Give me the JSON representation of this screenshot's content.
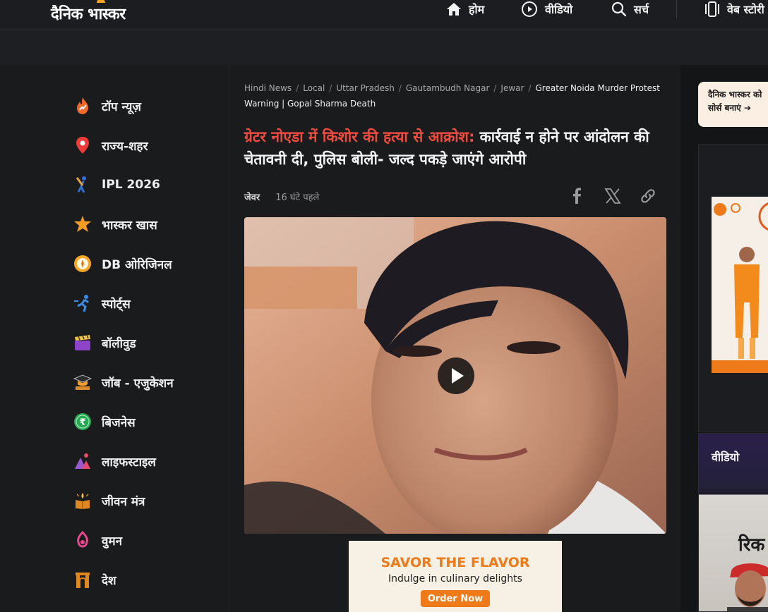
{
  "header": {
    "logo_text": "दैनिक भास्कर",
    "nav": [
      {
        "label": "होम",
        "icon": "home-icon"
      },
      {
        "label": "वीडियो",
        "icon": "play-circle-icon"
      },
      {
        "label": "सर्च",
        "icon": "search-icon"
      },
      {
        "label": "वेब स्टोरी",
        "icon": "web-story-icon"
      }
    ]
  },
  "sidebar": {
    "items": [
      {
        "label": "टॉप न्यूज़",
        "icon": "fire-icon"
      },
      {
        "label": "राज्य-शहर",
        "icon": "location-pin-icon"
      },
      {
        "label": "IPL 2026",
        "icon": "cricket-batter-icon"
      },
      {
        "label": "भास्कर खास",
        "icon": "star-burst-icon"
      },
      {
        "label": "DB ओरिजिनल",
        "icon": "db-original-icon"
      },
      {
        "label": "स्पोर्ट्स",
        "icon": "runner-icon"
      },
      {
        "label": "बॉलीवुड",
        "icon": "clapperboard-icon"
      },
      {
        "label": "जॉब - एजुकेशन",
        "icon": "graduation-cap-icon"
      },
      {
        "label": "बिजनेस",
        "icon": "rupee-coin-icon"
      },
      {
        "label": "लाइफस्टाइल",
        "icon": "lifestyle-icon"
      },
      {
        "label": "जीवन मंत्र",
        "icon": "book-lamp-icon"
      },
      {
        "label": "वुमन",
        "icon": "woman-symbol-icon"
      },
      {
        "label": "देश",
        "icon": "india-gate-icon"
      }
    ]
  },
  "article": {
    "breadcrumbs": [
      "Hindi News",
      "Local",
      "Uttar Pradesh",
      "Gautambudh Nagar",
      "Jewar"
    ],
    "breadcrumb_current": "Greater Noida Murder Protest Warning | Gopal Sharma Death",
    "headline_highlight": "ग्रेटर नोएडा में किशोर की हत्या से आक्रोश:",
    "headline_rest": " कार्रवाई न होने पर आंदोलन की चेतावनी दी, पुलिस बोली- जल्द पकड़े जाएंगे आरोपी",
    "location": "जेवर",
    "time_ago": "16 घंटे पहले",
    "share_icons": [
      "facebook-icon",
      "x-icon",
      "link-icon"
    ]
  },
  "ad": {
    "title": "SAVOR THE FLAVOR",
    "subtitle": "Indulge in culinary delights",
    "button": "Order Now",
    "accent": "#ee7a1a"
  },
  "right_rail": {
    "source_line1": "दैनिक भास्कर को",
    "source_line2": "सोर्स बनाएं ➔",
    "video_title": "वीडियो",
    "video_text": "रिक"
  },
  "colors": {
    "headline_accent": "#ef4b3f",
    "background": "#141517"
  }
}
